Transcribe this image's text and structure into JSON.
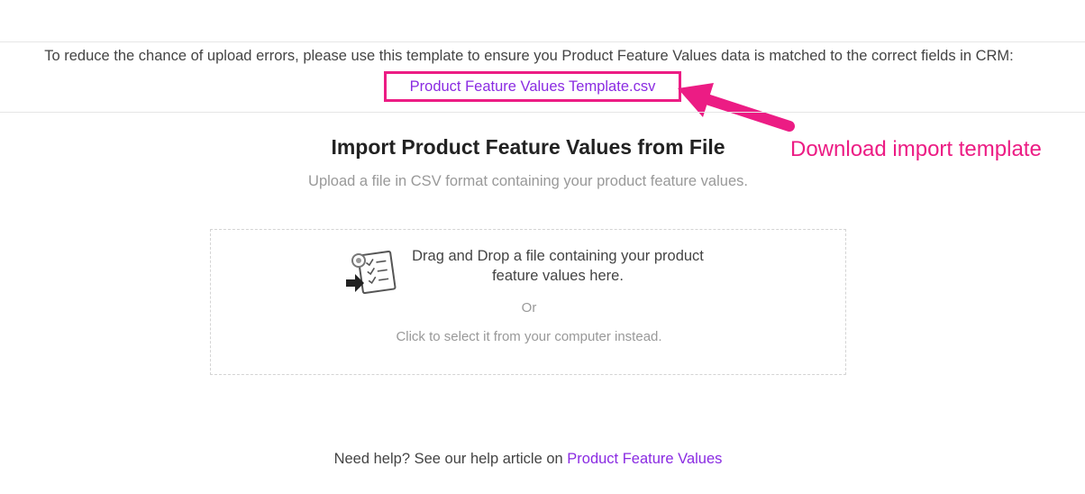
{
  "notice": {
    "text": "To reduce the chance of upload errors, please use this template to ensure you Product Feature Values data is matched to the correct fields in CRM:",
    "template_link": "Product Feature Values Template.csv"
  },
  "callout": {
    "text": "Download import template",
    "color": "#ec1c84"
  },
  "import": {
    "title": "Import Product Feature Values from File",
    "subtitle": "Upload a file in CSV format containing your product feature values."
  },
  "dropzone": {
    "icon": "file-import-icon",
    "line1": "Drag and Drop a file containing your product",
    "line2": "feature values here.",
    "or": "Or",
    "click_text": "Click to select it from your computer instead."
  },
  "help": {
    "prefix": "Need help? See our help article on ",
    "link": "Product Feature Values"
  },
  "colors": {
    "link": "#8a2be2",
    "accent": "#ec1c84"
  }
}
